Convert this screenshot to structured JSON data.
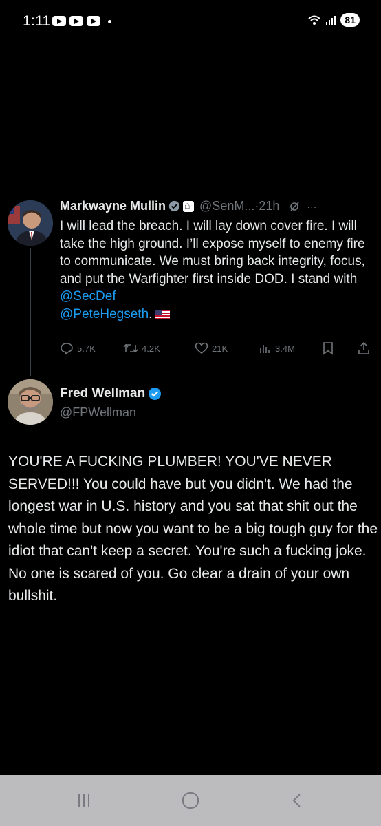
{
  "status_bar": {
    "time": "1:11",
    "battery": "81",
    "notification_icons": [
      "youtube-icon",
      "youtube-icon",
      "youtube-icon"
    ],
    "signal_icons": [
      "wifi-icon",
      "signal-bars-icon"
    ]
  },
  "tweet1": {
    "name": "Markwayne Mullin",
    "handle": "@SenM...",
    "time": "·21h",
    "body_1": "I will lead the breach. I will lay down cover fire. I will take the high ground. I’ll expose myself to enemy fire to communicate. We must bring back integrity, focus, and put the Warfighter first inside DOD. I stand with ",
    "mention_1": "@SecDef",
    "mention_2": "@PeteHegseth",
    "body_2": ".",
    "actions": {
      "replies": "5.7K",
      "reposts": "4.2K",
      "likes": "21K",
      "views": "3.4M"
    }
  },
  "tweet2": {
    "name": "Fred Wellman",
    "handle": "@FPWellman",
    "body": "YOU'RE A FUCKING PLUMBER! YOU'VE NEVER SERVED!!! You could have but you didn't.  We had the longest war in U.S. history and you sat that shit out the whole time but now you want to be a big tough guy for the idiot that can't keep a secret. You're such a fucking joke. No one is scared of you. Go clear a drain of your own bullshit."
  },
  "colors": {
    "background": "#000000",
    "text": "#e7e9ea",
    "muted": "#71767b",
    "link": "#1d9bf0",
    "verified": "#1d9bf0",
    "nav_bar": "#bcbcbf"
  }
}
